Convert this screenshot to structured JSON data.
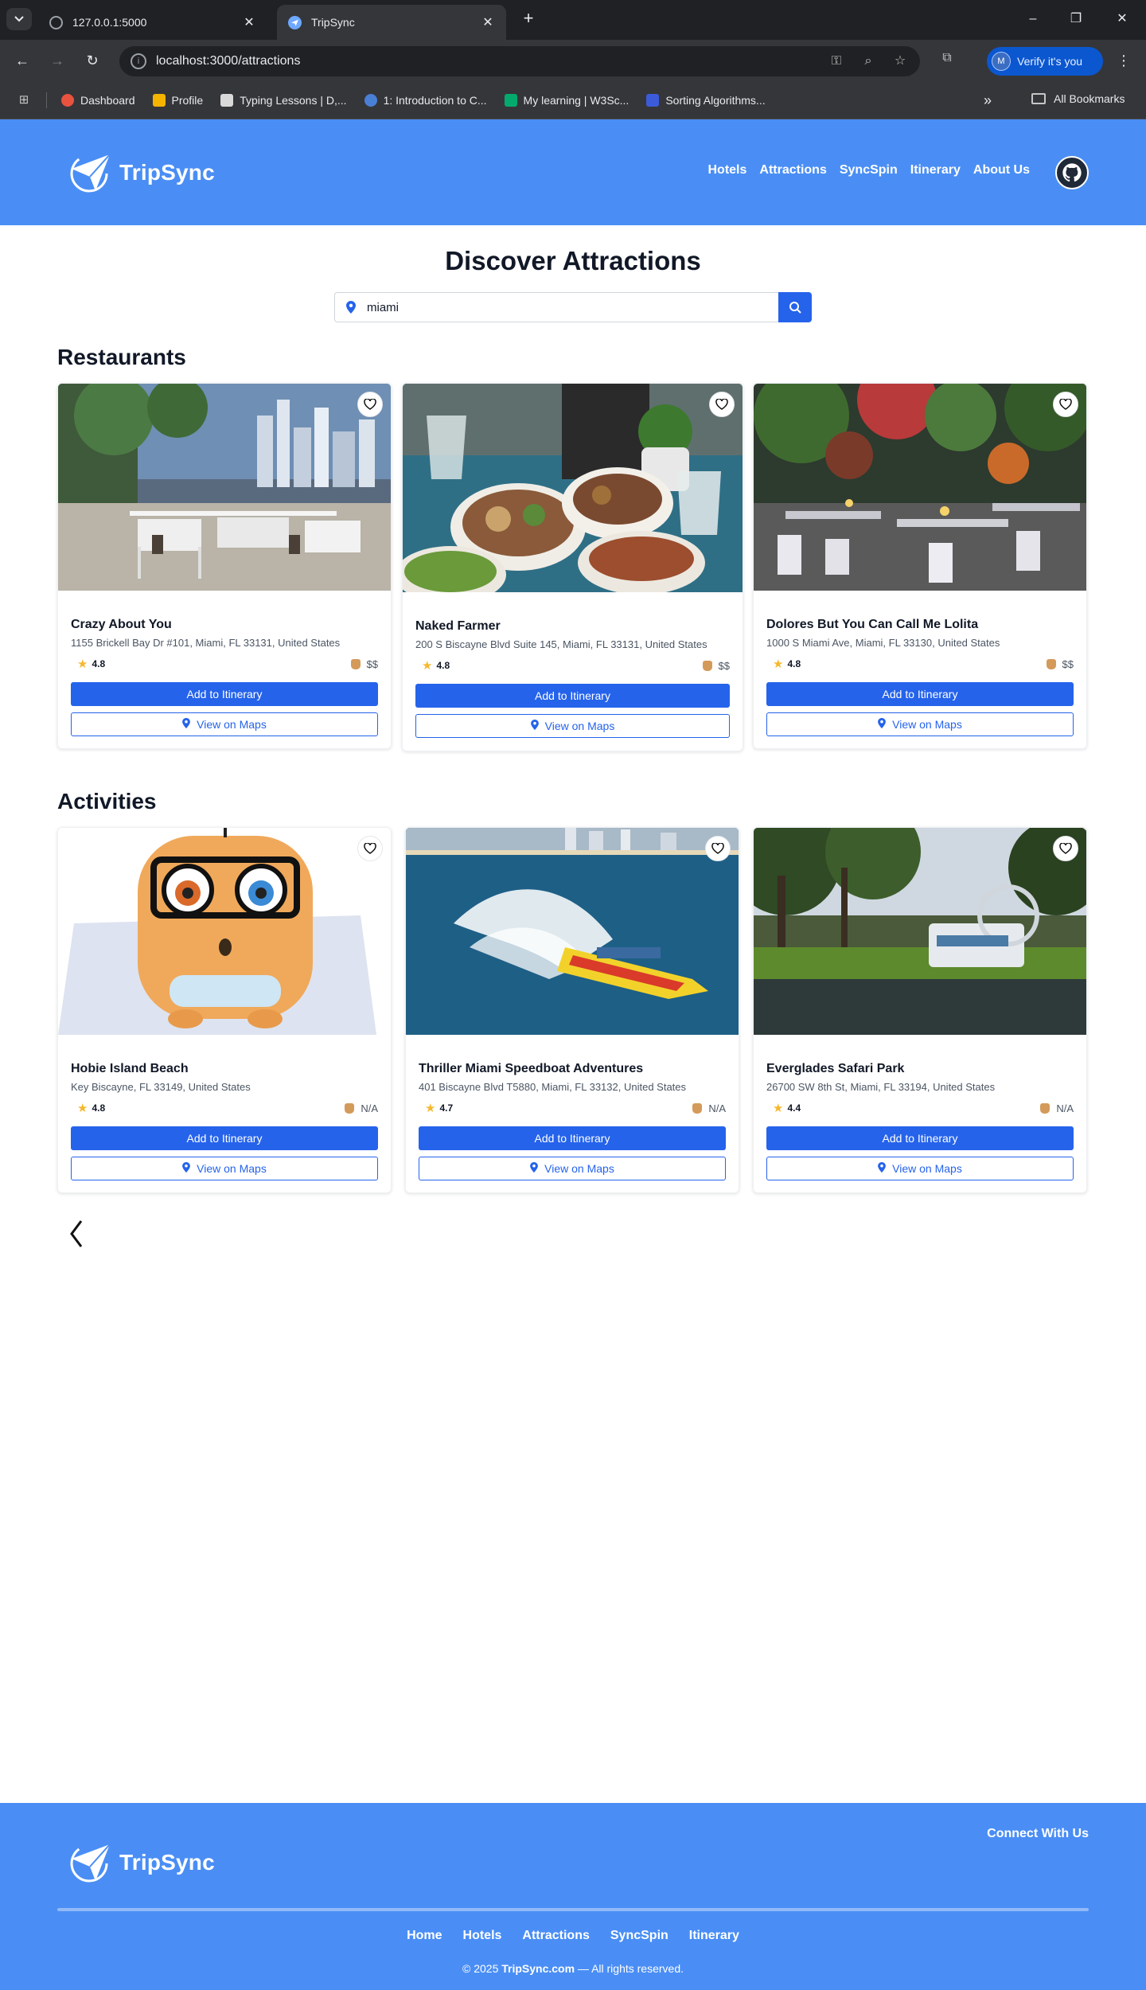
{
  "browser": {
    "tabs": [
      {
        "title": "127.0.0.1:5000",
        "active": false
      },
      {
        "title": "TripSync",
        "active": true
      }
    ],
    "url": "localhost:3000/attractions",
    "verify_label": "Verify it's you",
    "verify_avatar_letter": "M",
    "bookmarks": [
      {
        "label": "Dashboard",
        "color": "#e8533f"
      },
      {
        "label": "Profile",
        "color": "#f4b400"
      },
      {
        "label": "Typing Lessons | D,...",
        "color": "#d9d9d9"
      },
      {
        "label": "1: Introduction to C...",
        "color": "#4a7fd6"
      },
      {
        "label": "My learning | W3Sc...",
        "color": "#04aa6d"
      },
      {
        "label": "Sorting Algorithms...",
        "color": "#3b5bdb"
      }
    ],
    "all_bookmarks_label": "All Bookmarks"
  },
  "header": {
    "brand": "TripSync",
    "nav": [
      "Hotels",
      "Attractions",
      "SyncSpin",
      "Itinerary",
      "About Us"
    ]
  },
  "main": {
    "title": "Discover Attractions",
    "search_value": "miami",
    "restaurants_heading": "Restaurants",
    "activities_heading": "Activities",
    "add_label": "Add to Itinerary",
    "maps_label": "View on Maps",
    "restaurants": [
      {
        "name": "Crazy About You",
        "address": "1155 Brickell Bay Dr #101, Miami, FL 33131, United States",
        "rating": "4.8",
        "price": "$$"
      },
      {
        "name": "Naked Farmer",
        "address": "200 S Biscayne Blvd Suite 145, Miami, FL 33131, United States",
        "rating": "4.8",
        "price": "$$"
      },
      {
        "name": "Dolores But You Can Call Me Lolita",
        "address": "1000 S Miami Ave, Miami, FL 33130, United States",
        "rating": "4.8",
        "price": "$$"
      }
    ],
    "activities": [
      {
        "name": "Hobie Island Beach",
        "address": "Key Biscayne, FL 33149, United States",
        "rating": "4.8",
        "price": "N/A"
      },
      {
        "name": "Thriller Miami Speedboat Adventures",
        "address": "401 Biscayne Blvd T5880, Miami, FL 33132, United States",
        "rating": "4.7",
        "price": "N/A"
      },
      {
        "name": "Everglades Safari Park",
        "address": "26700 SW 8th St, Miami, FL 33194, United States",
        "rating": "4.4",
        "price": "N/A"
      }
    ]
  },
  "footer": {
    "brand": "TripSync",
    "connect": "Connect With Us",
    "links": [
      "Home",
      "Hotels",
      "Attractions",
      "SyncSpin",
      "Itinerary"
    ],
    "copyright_prefix": "© 2025 ",
    "copyright_brand": "TripSync.com",
    "copyright_suffix": " — All rights reserved."
  },
  "colors": {
    "brand_blue": "#4a8ef5",
    "button_blue": "#2563eb",
    "star": "#f5b82e"
  }
}
